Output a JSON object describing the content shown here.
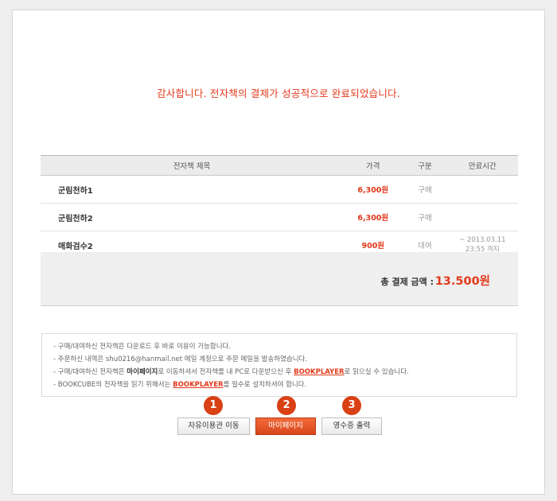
{
  "message": "감사합니다. 전자책의 결제가 성공적으로 완료되었습니다.",
  "table": {
    "headers": [
      "전자책 제목",
      "가격",
      "구분",
      "만료시간"
    ],
    "rows": [
      {
        "title": "군림천하1",
        "price": "6,300원",
        "type": "구매",
        "expire1": "",
        "expire2": ""
      },
      {
        "title": "군림천하2",
        "price": "6,300원",
        "type": "구매",
        "expire1": "",
        "expire2": ""
      },
      {
        "title": "매화검수2",
        "price": "900원",
        "type": "대여",
        "expire1": "~ 2013.03.11",
        "expire2": "23:55 까지"
      }
    ]
  },
  "total": {
    "label": "총 결제 금액 :",
    "amount": "13.500원"
  },
  "notes": {
    "line1": "- 구매/대여하신 전자책은 다운로드 후 바로 이용이 가능합니다.",
    "line2": "- 주문하신 내역은 shu0216@hanmail.net 메일 계정으로 주문 메일을 발송하였습니다.",
    "line3_a": "- 구매/대여하신 전자책은 ",
    "line3_b": "마이페이지",
    "line3_c": "로 이동하셔서 전자책를 내 PC로 다운받으신 후 ",
    "line3_d": "BOOKPLAYER",
    "line3_e": "로 읽으실 수 있습니다.",
    "line4_a": "- BOOKCUBE의 전자책을 읽기 위해서는 ",
    "line4_b": "BOOKPLAYER",
    "line4_c": "를 필수로 설치하셔야 합니다."
  },
  "buttons": {
    "free_zone": "자유이용관 이동",
    "mypage": "마이페이지",
    "receipt": "영수증 출력"
  },
  "markers": [
    "1",
    "2",
    "3"
  ],
  "colors": {
    "accent": "#e3391c",
    "button_primary": "#d9461c",
    "marker": "#d94013"
  }
}
